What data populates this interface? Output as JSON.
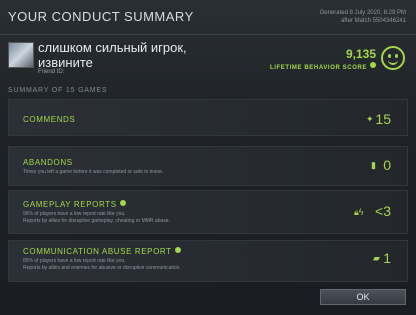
{
  "header": {
    "title": "YOUR CONDUCT SUMMARY",
    "generated": "Generated 8 July 2020, 8:29 PM",
    "after_match": "after Match 5504346241"
  },
  "player": {
    "name": "слишком сильный игрок, извините",
    "friend_id_label": "Friend ID:"
  },
  "score": {
    "value": "9,135",
    "label": "LIFETIME BEHAVIOR SCORE",
    "icon": "smiley-face-icon"
  },
  "summary_label": "SUMMARY OF 15 GAMES",
  "cards": [
    {
      "title": "COMMENDS",
      "desc1": "",
      "desc2": "",
      "value": "15",
      "icon": "commend-star-icon"
    },
    {
      "title": "ABANDONS",
      "desc1": "Times you left a game before it was completed or safe to leave.",
      "desc2": "",
      "value": "0",
      "icon": "abandon-door-icon"
    },
    {
      "title": "GAMEPLAY REPORTS",
      "desc1": "96% of players have a low report rate like you.",
      "desc2": "Reports by allies for disruptive gameplay, cheating or MMR abuse.",
      "value": "<3",
      "icon": "lock-lightning-icon"
    },
    {
      "title": "COMMUNICATION ABUSE REPORT",
      "desc1": "85% of players have a low report rate like you.",
      "desc2": "Reports by allies and enemies for abusive or disruptive communication.",
      "value": "1",
      "icon": "chat-bubble-icon"
    }
  ],
  "ok_button": "OK",
  "colors": {
    "accent": "#a5d64a",
    "background": "#1b1e22"
  }
}
